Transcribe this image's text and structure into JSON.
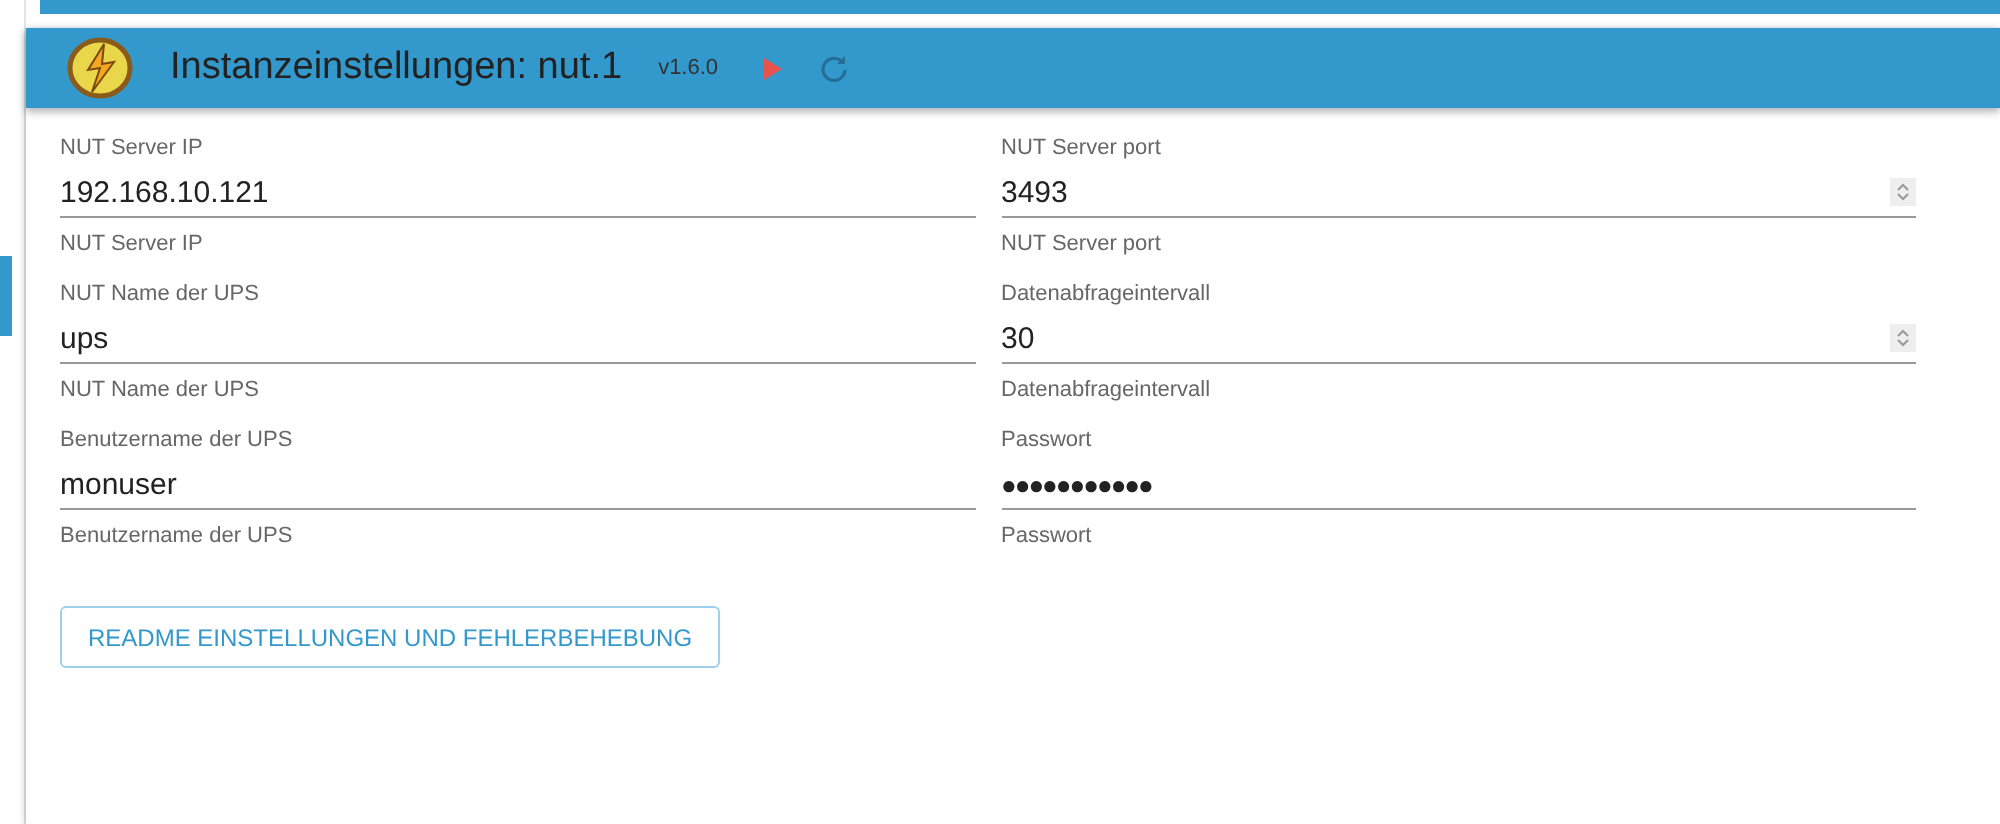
{
  "header": {
    "title": "Instanzeinstellungen: nut.1",
    "version": "v1.6.0"
  },
  "fields": [
    {
      "label": "NUT Server IP",
      "value": "192.168.10.121",
      "helper": "NUT Server IP",
      "kind": "text"
    },
    {
      "label": "NUT Server port",
      "value": "3493",
      "helper": "NUT Server port",
      "kind": "number"
    },
    {
      "label": "NUT Name der UPS",
      "value": "ups",
      "helper": "NUT Name der UPS",
      "kind": "text"
    },
    {
      "label": "Datenabfrageintervall",
      "value": "30",
      "helper": "Datenabfrageintervall",
      "kind": "number"
    },
    {
      "label": "Benutzername der UPS",
      "value": "monuser",
      "helper": "Benutzername der UPS",
      "kind": "text"
    },
    {
      "label": "Passwort",
      "value": "●●●●●●●●●●●",
      "helper": "Passwort",
      "kind": "password"
    }
  ],
  "button": "README EINSTELLUNGEN UND FEHLERBEHEBUNG"
}
